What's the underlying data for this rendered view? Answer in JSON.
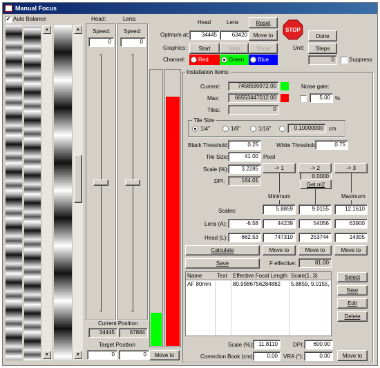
{
  "title": "Manual Focus",
  "auto_balance": "Auto Balance",
  "head_col": {
    "label": "Head:",
    "speed_label": "Speed:",
    "speed": "0"
  },
  "lens_col": {
    "label": "Lens:",
    "speed_label": "Speed:",
    "speed": "0"
  },
  "current_position": {
    "label": "Current Position",
    "head": "34445",
    "lens": "67884"
  },
  "target_position": {
    "label": "Target Position",
    "head": "0",
    "lens": "0"
  },
  "move_to_left": "Move to",
  "top": {
    "head_hdr": "Head",
    "lens_hdr": "Lens",
    "reset": "Reset",
    "optimum_label": "Optmum at:",
    "optimum_head": "34445",
    "optimum_lens": "63420",
    "move_to": "Move to",
    "stop": "STOP",
    "done": "Done",
    "graphics_label": "Graphics:",
    "start": "Start",
    "stop_btn": "Stop",
    "show": "Show",
    "unit_label": "Unit:",
    "steps": "Steps",
    "channel_label": "Channel:",
    "red": "Red",
    "green": "Green",
    "blue": "Blue",
    "counter": "0",
    "suppress": "Suppress"
  },
  "install": {
    "label": "Installation Items:",
    "current_label": "Current:",
    "current": "7458590972.00",
    "max_label": "Max:",
    "max": "66553447012.00",
    "tiles_label": "Tiles:",
    "tiles": "0",
    "noise_label": "Noise gate:",
    "noise": "5.00",
    "pct": "%"
  },
  "tile_size": {
    "label": "Tile Size",
    "opt1": "1/4\"",
    "opt2": "1/8\"",
    "opt3": "1/16\"",
    "custom": "0.10000000",
    "unit": "cm"
  },
  "black_label": "Black Threshold:",
  "black": "0.25",
  "white_label": "White Threshold:",
  "white": "0.75",
  "tile_label": "Tile Size:",
  "tile": "41.00",
  "pixel": "Pixel",
  "scale_label": "Scale (%):",
  "scale": "3.2285",
  "dpi_label": "DPI:",
  "dpi": "164.01",
  "arrows": {
    "a1": "-> 1",
    "a2": "-> 2",
    "a3": "-> 3",
    "mid": "0.0000",
    "getm2": "Get m2",
    "minimum": "Minimum",
    "maximum": "Maximum"
  },
  "scales_label": "Scales:",
  "scales": [
    "5.8859",
    "9.0155",
    "12.1610"
  ],
  "lens_a_label": "Lens (A):",
  "lens_a": [
    "-6.58",
    "44239",
    "54056",
    "63900"
  ],
  "head_l_label": "Head (L):",
  "head_l": [
    "662.53",
    "747310",
    "253744",
    "14305"
  ],
  "calculate": "Calculate",
  "move_to": "Move to",
  "save": "Save",
  "feff_label": "F effective:",
  "feff": "81.00",
  "table": {
    "headers": [
      "Name",
      "Text",
      "Effective Focal Length",
      "Scale(1..3)"
    ],
    "row": [
      "AF 80mm",
      "",
      "80.9986756284882",
      "5.8859, 9.0155, 1"
    ]
  },
  "list_btns": {
    "select": "Select",
    "new": "New",
    "edit": "Edit",
    "delete": "Delete"
  },
  "bottom": {
    "scale_label": "Scale (%):",
    "scale": "11.8110",
    "dpi_label": "DPI:",
    "dpi": "600.00",
    "corr_label": "Correction Book (cm):",
    "corr": "0.00",
    "vra_label": "VRA (°):",
    "vra": "0.00",
    "move_to": "Move to"
  },
  "colors": {
    "green": "#00ff00",
    "red": "#ff0000",
    "blue": "#0000ff"
  },
  "bars": {
    "green_level": 0.12,
    "red_level": 0.9
  }
}
